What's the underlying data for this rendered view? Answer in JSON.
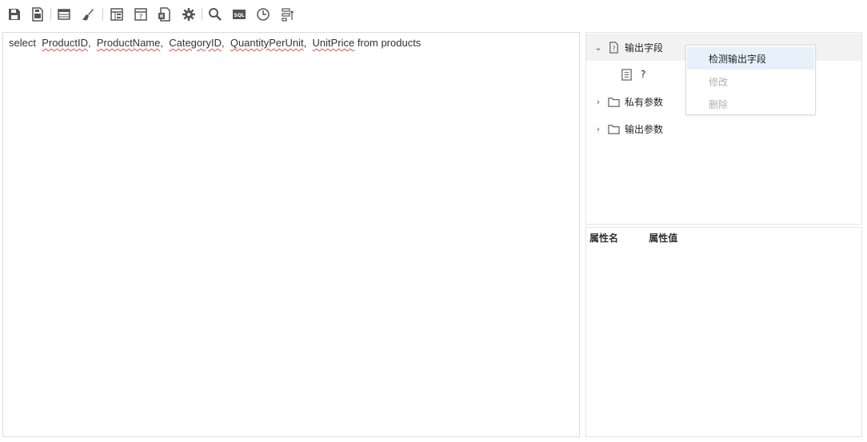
{
  "toolbar": {
    "buttons": [
      {
        "name": "save-icon"
      },
      {
        "name": "save-as-icon"
      },
      {
        "name": "table-icon"
      },
      {
        "name": "format-brush-icon"
      },
      {
        "name": "layout-icon"
      },
      {
        "name": "parameter-icon"
      },
      {
        "name": "export-excel-icon"
      },
      {
        "name": "settings-gear-icon"
      },
      {
        "name": "search-icon"
      },
      {
        "name": "sql-icon",
        "text": "SQL"
      },
      {
        "name": "clock-icon"
      },
      {
        "name": "field-list-icon"
      }
    ]
  },
  "editor": {
    "keyword_select": "select",
    "fields": [
      "ProductID",
      "ProductName",
      "CategoryID",
      "QuantityPerUnit",
      "UnitPrice"
    ],
    "separator": ",",
    "tail": "from products"
  },
  "tree": {
    "nodes": [
      {
        "label": "输出字段",
        "expanded": true,
        "caret": "⌄"
      },
      {
        "label": "?"
      },
      {
        "label": "私有参数",
        "expanded": false,
        "caret": "›"
      },
      {
        "label": "输出参数",
        "expanded": false,
        "caret": "›"
      }
    ]
  },
  "context_menu": {
    "items": [
      {
        "label": "检测输出字段",
        "enabled": true
      },
      {
        "label": "修改",
        "enabled": false
      },
      {
        "label": "删除",
        "enabled": false
      }
    ]
  },
  "properties": {
    "col_name": "属性名",
    "col_value": "属性值"
  },
  "colors": {
    "icon": "#555555",
    "menu_hover": "#e6f1fb",
    "squiggle": "#d9534f"
  }
}
